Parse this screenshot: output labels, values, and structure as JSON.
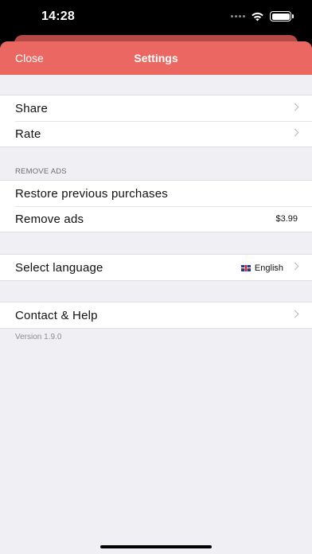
{
  "status_bar": {
    "time": "14:28"
  },
  "navbar": {
    "close_label": "Close",
    "title": "Settings"
  },
  "group1": {
    "items": [
      {
        "label": "Share"
      },
      {
        "label": "Rate"
      }
    ]
  },
  "remove_ads": {
    "header": "REMOVE ADS",
    "restore_label": "Restore previous purchases",
    "remove_label": "Remove ads",
    "price": "$3.99"
  },
  "language": {
    "label": "Select language",
    "value": "English"
  },
  "contact": {
    "label": "Contact & Help"
  },
  "footer": {
    "version": "Version 1.9.0"
  },
  "colors": {
    "accent": "#eb6761",
    "background": "#efeff4"
  }
}
